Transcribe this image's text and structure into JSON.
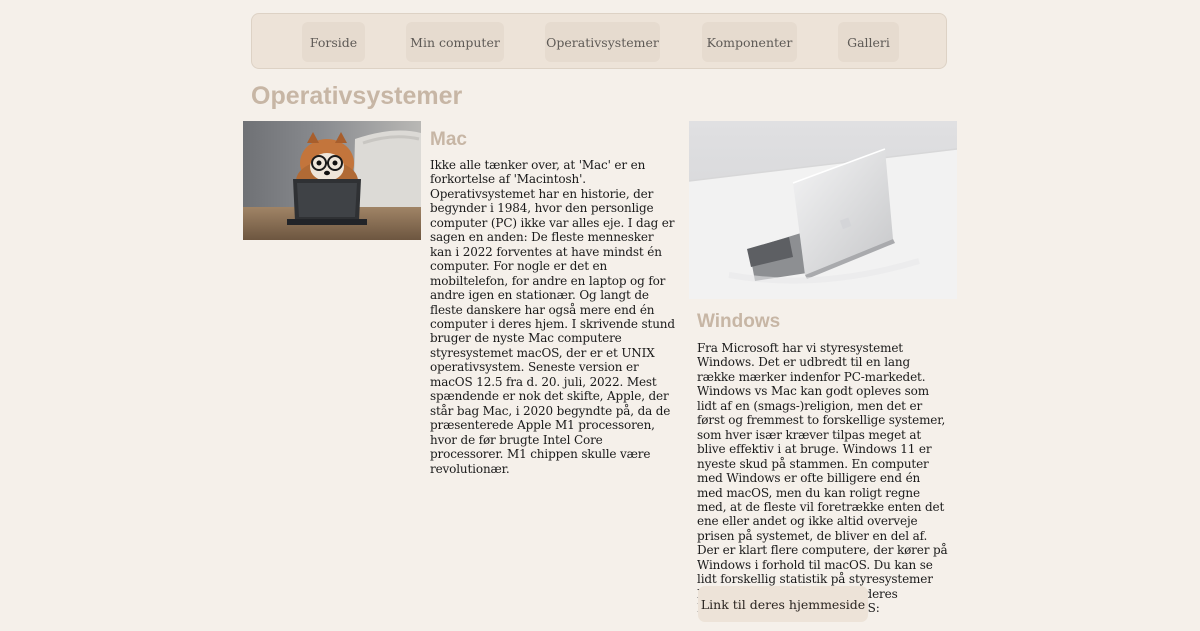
{
  "nav": {
    "items": [
      {
        "label": "Forside"
      },
      {
        "label": "Min computer"
      },
      {
        "label": "Operativsystemer"
      },
      {
        "label": "Komponenter"
      },
      {
        "label": "Galleri"
      }
    ]
  },
  "page": {
    "title": "Operativsystemer"
  },
  "mac": {
    "title": "Mac",
    "text": "Ikke alle tænker over, at 'Mac' er en forkortelse af 'Macintosh'. Operativsystemet har en historie, der begynder i 1984, hvor den personlige computer (PC) ikke var alles eje. I dag er sagen en anden: De fleste mennesker kan i 2022 forventes at have mindst én computer. For nogle er det en mobiltelefon, for andre en laptop og for andre igen en stationær. Og langt de fleste danskere har også mere end én computer i deres hjem. I skrivende stund bruger de nyste Mac computere styresystemet macOS, der er et UNIX operativsystem. Seneste version er macOS 12.5 fra d. 20. juli, 2022. Mest spændende er nok det skifte, Apple, der står bag Mac, i 2020 begyndte på, da de præsenterede Apple M1 processoren, hvor de før brugte Intel Core processorer. M1 chippen skulle være revolutionær."
  },
  "windows": {
    "title": "Windows",
    "text": "Fra Microsoft har vi styresystemet Windows. Det er udbredt til en lang række mærker indenfor PC-markedet. Windows vs Mac kan godt opleves som lidt af en (smags-)religion, men det er først og fremmest to forskellige systemer, som hver især kræver tilpas meget at blive effektiv i at bruge. Windows 11 er nyeste skud på stammen. En computer med Windows er ofte billigere end én med macOS, men du kan roligt regne med, at de fleste vil foretrække enten det ene eller andet og ikke altid overveje prisen på systemet, de bliver en del af. Der er klart flere computere, der kører på Windows i forhold til macOS. Du kan se lidt forskellig statistik på styresystemer hos f.eks. W3Schools under deres Browser Stats > Browsers OS:",
    "link_label": "Link til deres hjemmeside"
  }
}
